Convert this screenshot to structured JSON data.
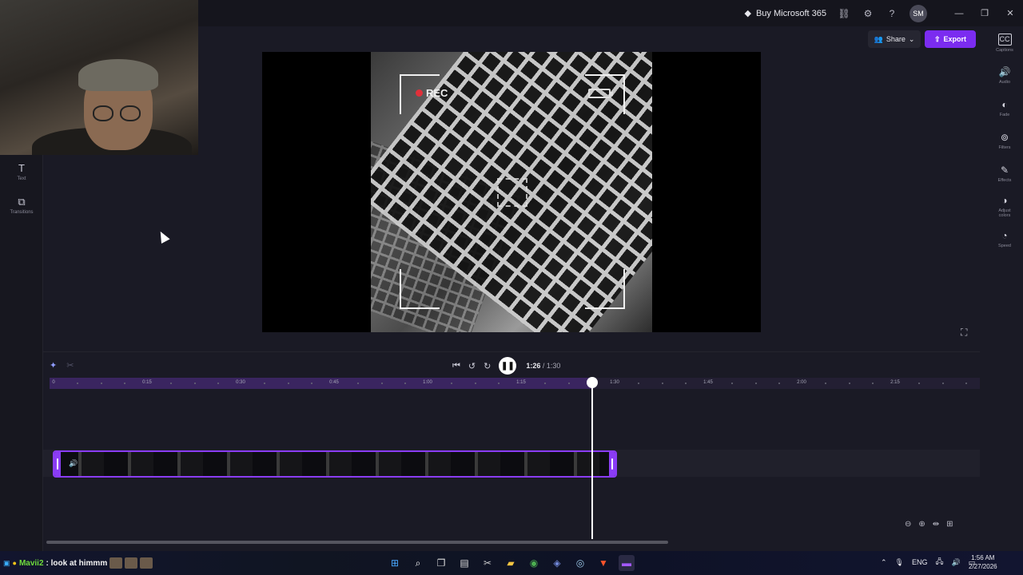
{
  "titlebar": {
    "buy_label": "Buy Microsoft 365",
    "avatar_initials": "SM"
  },
  "toolbar": {
    "share_label": "Share",
    "export_label": "Export"
  },
  "left_rail": [
    {
      "label": "Text",
      "icon": "T"
    },
    {
      "label": "Transitions",
      "icon": "⧉"
    }
  ],
  "right_rail": [
    {
      "label": "Captions",
      "icon": "CC"
    },
    {
      "label": "Audio",
      "icon": "🔊"
    },
    {
      "label": "Fade",
      "icon": "◐"
    },
    {
      "label": "Filters",
      "icon": "⊚"
    },
    {
      "label": "Effects",
      "icon": "✎"
    },
    {
      "label": "Adjust colors",
      "icon": "◑"
    },
    {
      "label": "Speed",
      "icon": "◔"
    }
  ],
  "preview": {
    "rec_label": "REC"
  },
  "playback": {
    "current_time": "1:26",
    "total_time": "/ 1:30",
    "progress": 0.956
  },
  "ruler": {
    "labels": [
      "0",
      "0:15",
      "0:30",
      "0:45",
      "1:00",
      "1:15",
      "1:30",
      "1:45",
      "2:00",
      "2:15"
    ]
  },
  "taskbar": {
    "chat_user": "Mavii2",
    "chat_message": ": look at himmm",
    "lang": "ENG",
    "time": "1:56 AM",
    "date": "2/27/2026"
  },
  "colors": {
    "accent": "#7b2cf0",
    "clip_border": "#8a3cf5",
    "background": "#1a1a25"
  }
}
